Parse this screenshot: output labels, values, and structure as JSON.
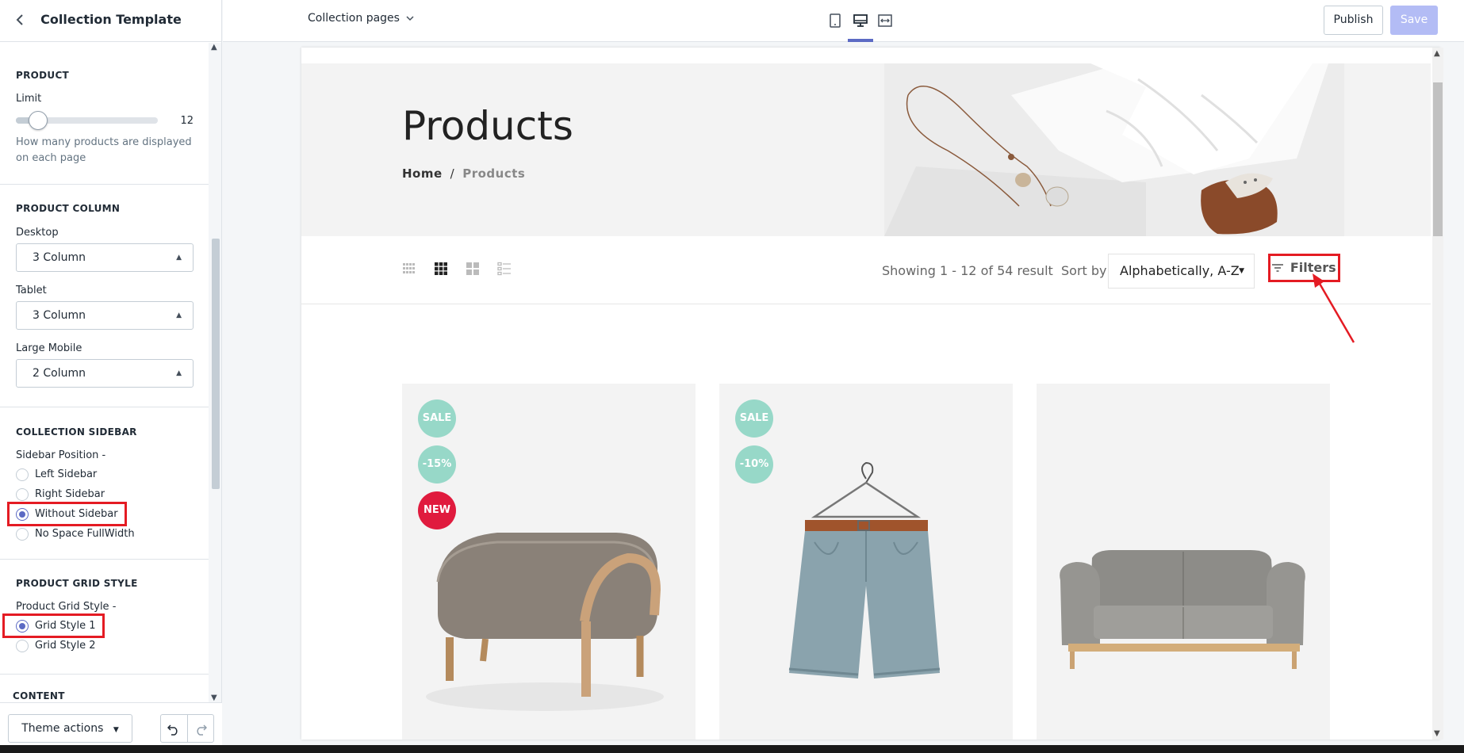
{
  "sidebar": {
    "title": "Collection Template",
    "product": {
      "section_title": "PRODUCT",
      "limit_label": "Limit",
      "limit_value": "12",
      "limit_fraction": 0.1,
      "limit_help": "How many products are displayed on each page"
    },
    "product_column": {
      "section_title": "PRODUCT COLUMN",
      "desktop_label": "Desktop",
      "desktop_value": "3 Column",
      "tablet_label": "Tablet",
      "tablet_value": "3 Column",
      "large_mobile_label": "Large Mobile",
      "large_mobile_value": "2 Column"
    },
    "collection_sidebar": {
      "section_title": "COLLECTION SIDEBAR",
      "position_label": "Sidebar Position -",
      "options": [
        "Left Sidebar",
        "Right Sidebar",
        "Without Sidebar",
        "No Space FullWidth"
      ],
      "selected": "Without Sidebar"
    },
    "grid_style": {
      "section_title": "PRODUCT GRID STYLE",
      "style_label": "Product Grid Style -",
      "options": [
        "Grid Style 1",
        "Grid Style 2"
      ],
      "selected": "Grid Style 1"
    },
    "content": {
      "section_title": "CONTENT"
    },
    "footer": {
      "theme_actions_label": "Theme actions"
    }
  },
  "topbar": {
    "page_select": "Collection pages",
    "publish_label": "Publish",
    "save_label": "Save",
    "active_device": "desktop"
  },
  "preview": {
    "hero_title": "Products",
    "breadcrumb_home": "Home",
    "breadcrumb_sep": "/",
    "breadcrumb_current": "Products",
    "showing_text": "Showing 1 - 12 of 54 result",
    "sort_by_label": "Sort by",
    "sort_value": "Alphabetically, A-Z",
    "filters_label": "Filters",
    "products": [
      {
        "badges": [
          "SALE",
          "-15%",
          "NEW"
        ],
        "image": "ottoman"
      },
      {
        "badges": [
          "SALE",
          "-10%"
        ],
        "image": "shorts"
      },
      {
        "badges": [],
        "image": "sofa"
      }
    ]
  },
  "colors": {
    "accent": "#5c6ac4",
    "badge_mint": "#97d8c8",
    "badge_new": "#e01b3e",
    "annotation_red": "#e41b23"
  }
}
